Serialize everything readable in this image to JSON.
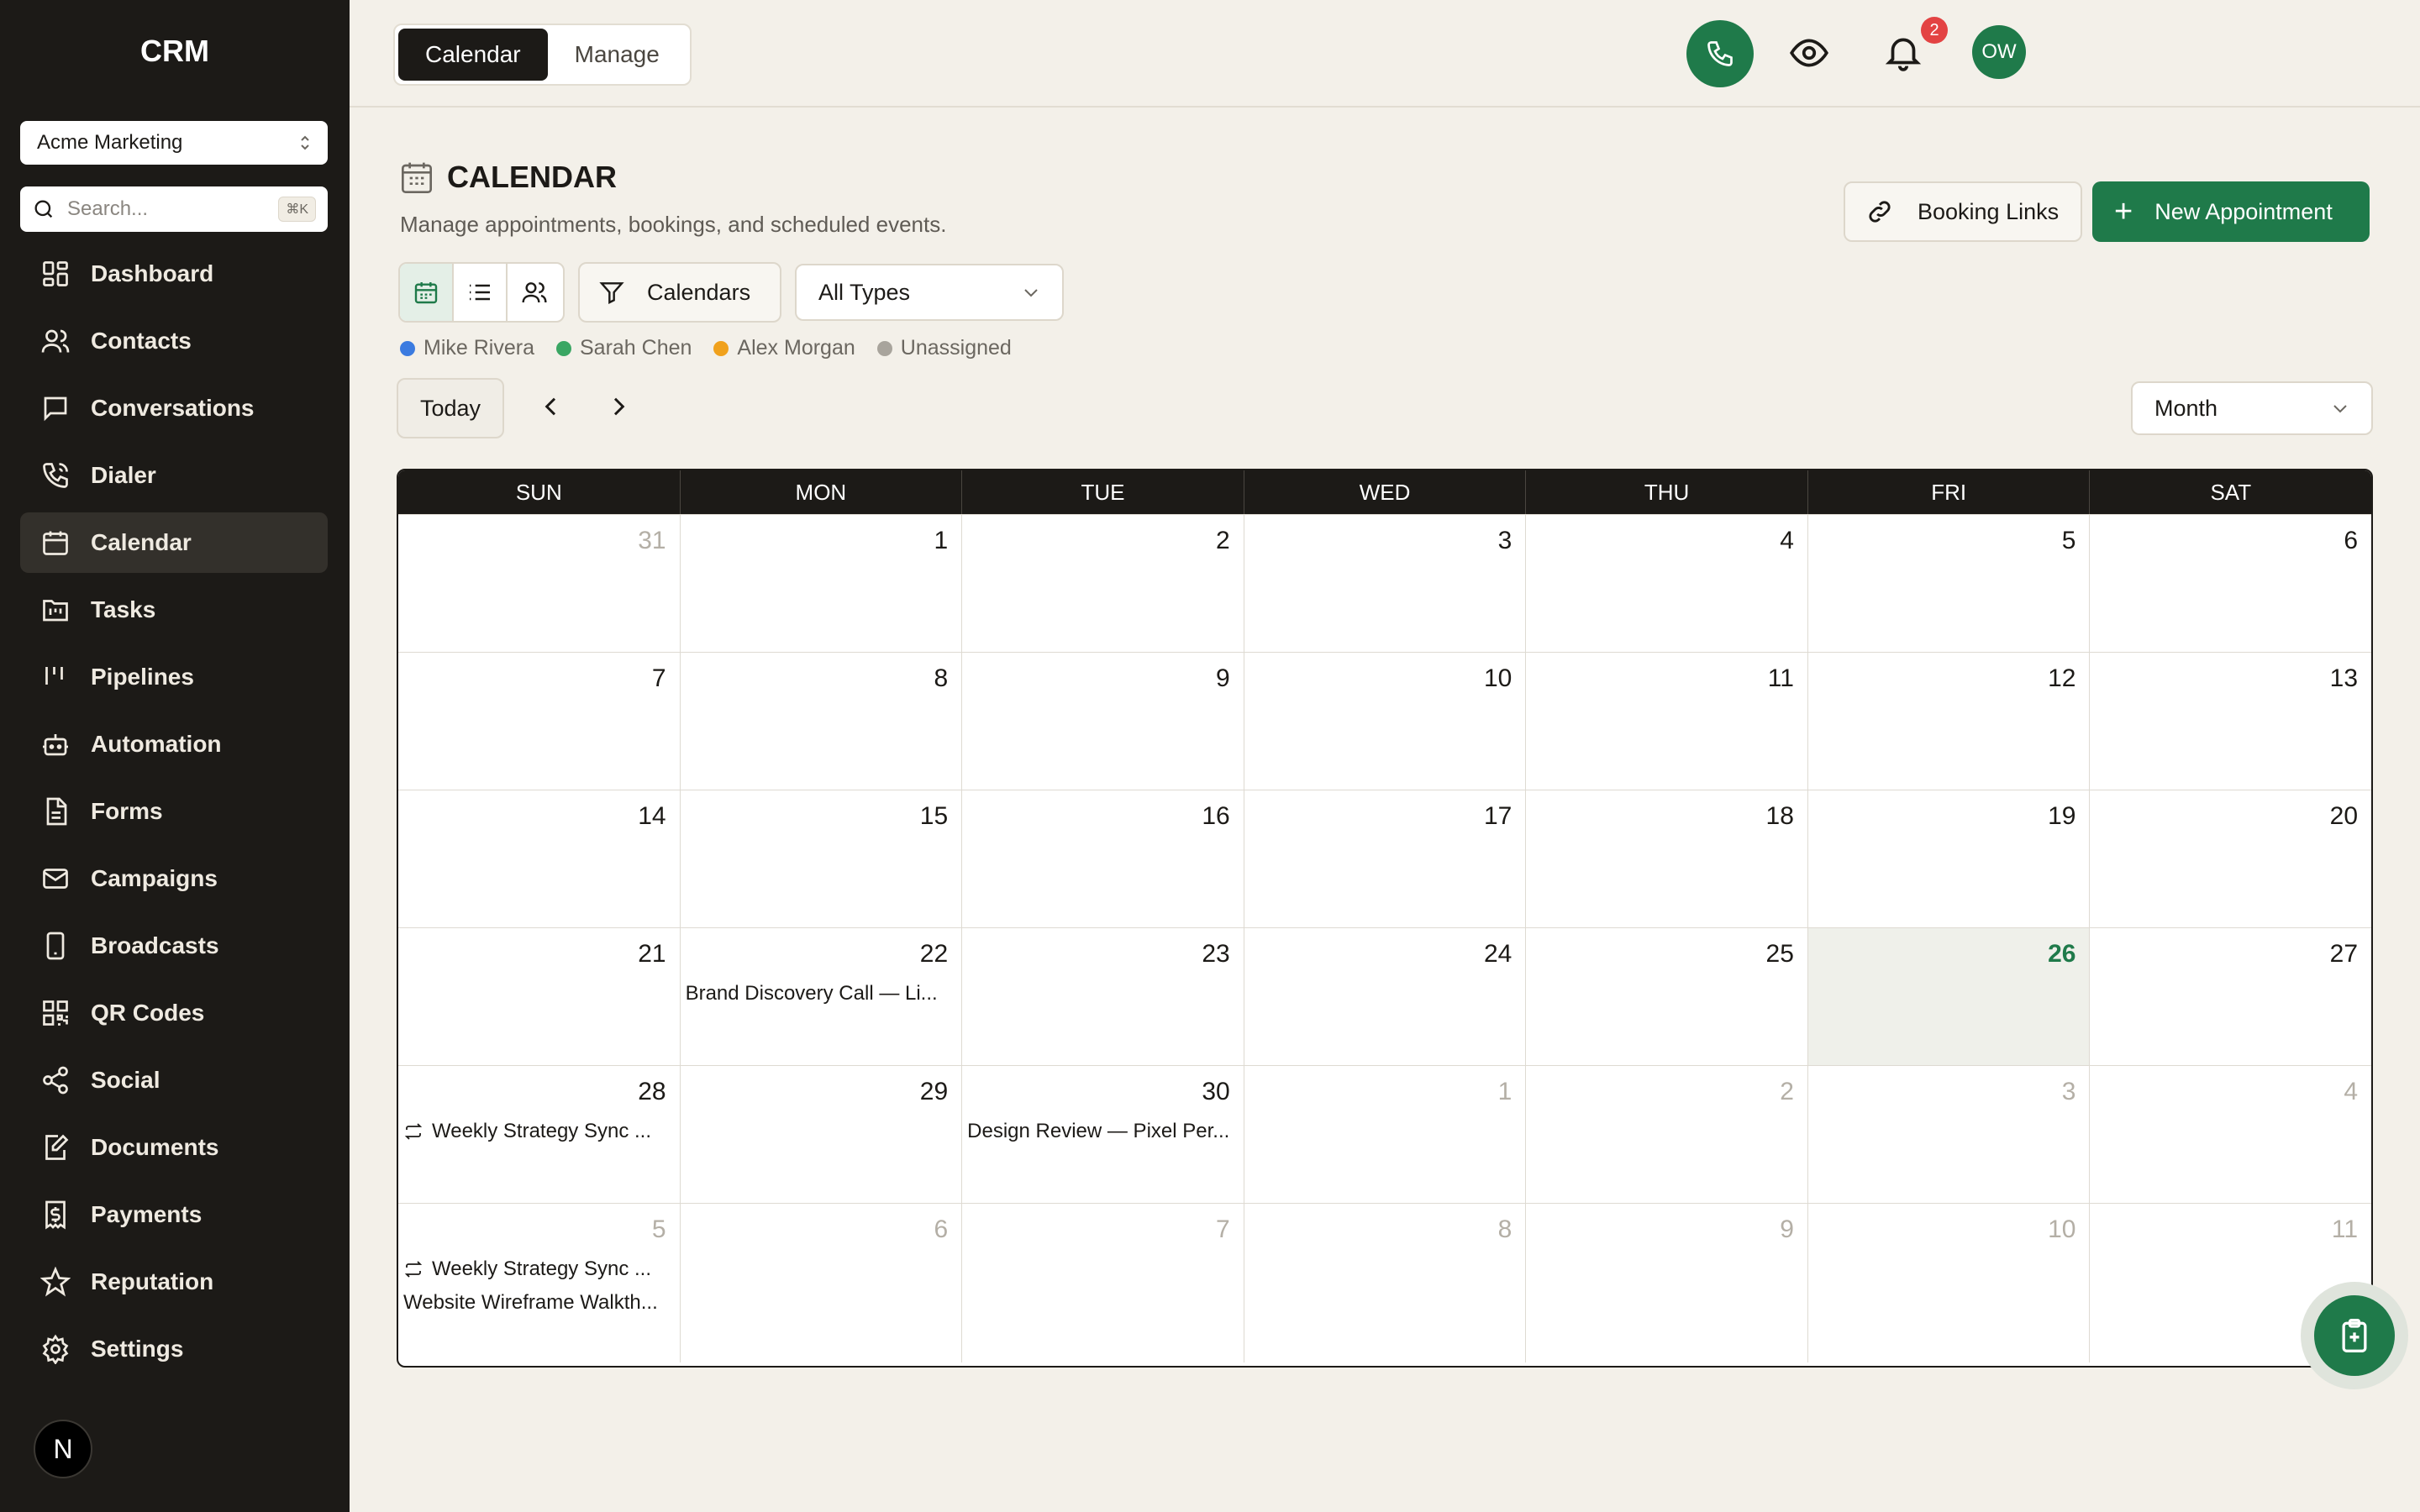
{
  "sidebar": {
    "brand": "CRM",
    "workspace": "Acme Marketing",
    "search_placeholder": "Search...",
    "search_shortcut": "⌘K",
    "items": [
      {
        "label": "Dashboard",
        "icon": "dashboard-icon"
      },
      {
        "label": "Contacts",
        "icon": "contacts-icon"
      },
      {
        "label": "Conversations",
        "icon": "chat-icon"
      },
      {
        "label": "Dialer",
        "icon": "phone-icon"
      },
      {
        "label": "Calendar",
        "icon": "calendar-icon",
        "active": true
      },
      {
        "label": "Tasks",
        "icon": "tasks-folder-icon"
      },
      {
        "label": "Pipelines",
        "icon": "pipelines-icon"
      },
      {
        "label": "Automation",
        "icon": "bot-icon"
      },
      {
        "label": "Forms",
        "icon": "form-icon"
      },
      {
        "label": "Campaigns",
        "icon": "mail-icon"
      },
      {
        "label": "Broadcasts",
        "icon": "mobile-icon"
      },
      {
        "label": "QR Codes",
        "icon": "qr-icon"
      },
      {
        "label": "Social",
        "icon": "share-icon"
      },
      {
        "label": "Documents",
        "icon": "document-edit-icon"
      },
      {
        "label": "Payments",
        "icon": "receipt-dollar-icon"
      },
      {
        "label": "Reputation",
        "icon": "star-icon"
      },
      {
        "label": "Settings",
        "icon": "gear-icon"
      }
    ],
    "footer_avatar": "N"
  },
  "topbar": {
    "tabs": [
      {
        "label": "Calendar",
        "active": true
      },
      {
        "label": "Manage",
        "active": false
      }
    ],
    "notification_count": "2",
    "user_initials": "OW"
  },
  "header": {
    "title": "CALENDAR",
    "subtitle": "Manage appointments, bookings, and scheduled events.",
    "booking_links_label": "Booking Links",
    "new_appointment_label": "New Appointment"
  },
  "toolbar": {
    "calendars_label": "Calendars",
    "type_filter": "All Types",
    "today_label": "Today",
    "view_mode": "Month"
  },
  "legend": [
    {
      "name": "Mike Rivera",
      "color": "#3b7be0"
    },
    {
      "name": "Sarah Chen",
      "color": "#3aa663"
    },
    {
      "name": "Alex Morgan",
      "color": "#f0a11c"
    },
    {
      "name": "Unassigned",
      "color": "#a8a49c"
    }
  ],
  "calendar": {
    "weekdays": [
      "SUN",
      "MON",
      "TUE",
      "WED",
      "THU",
      "FRI",
      "SAT"
    ],
    "weeks": [
      [
        {
          "day": "31",
          "muted": true
        },
        {
          "day": "1"
        },
        {
          "day": "2"
        },
        {
          "day": "3"
        },
        {
          "day": "4"
        },
        {
          "day": "5"
        },
        {
          "day": "6"
        }
      ],
      [
        {
          "day": "7"
        },
        {
          "day": "8"
        },
        {
          "day": "9"
        },
        {
          "day": "10"
        },
        {
          "day": "11"
        },
        {
          "day": "12"
        },
        {
          "day": "13"
        }
      ],
      [
        {
          "day": "14"
        },
        {
          "day": "15"
        },
        {
          "day": "16"
        },
        {
          "day": "17"
        },
        {
          "day": "18"
        },
        {
          "day": "19"
        },
        {
          "day": "20"
        }
      ],
      [
        {
          "day": "21"
        },
        {
          "day": "22",
          "events": [
            {
              "title": "Brand Discovery Call — Li..."
            }
          ]
        },
        {
          "day": "23"
        },
        {
          "day": "24"
        },
        {
          "day": "25"
        },
        {
          "day": "26",
          "today": true
        },
        {
          "day": "27"
        }
      ],
      [
        {
          "day": "28",
          "events": [
            {
              "title": "Weekly Strategy Sync ...",
              "recurring": true
            }
          ]
        },
        {
          "day": "29"
        },
        {
          "day": "30",
          "events": [
            {
              "title": "Design Review — Pixel Per..."
            }
          ]
        },
        {
          "day": "1",
          "muted": true
        },
        {
          "day": "2",
          "muted": true
        },
        {
          "day": "3",
          "muted": true
        },
        {
          "day": "4",
          "muted": true
        }
      ],
      [
        {
          "day": "5",
          "muted": true,
          "events": [
            {
              "title": "Weekly Strategy Sync ...",
              "recurring": true
            },
            {
              "title": "Website Wireframe Walkth..."
            }
          ]
        },
        {
          "day": "6",
          "muted": true
        },
        {
          "day": "7",
          "muted": true
        },
        {
          "day": "8",
          "muted": true
        },
        {
          "day": "9",
          "muted": true
        },
        {
          "day": "10",
          "muted": true
        },
        {
          "day": "11",
          "muted": true
        }
      ]
    ]
  },
  "colors": {
    "accent": "#1f7a4a",
    "sidebar_bg": "#1c1a17",
    "page_bg": "#f3f0e9",
    "badge": "#e34343"
  }
}
